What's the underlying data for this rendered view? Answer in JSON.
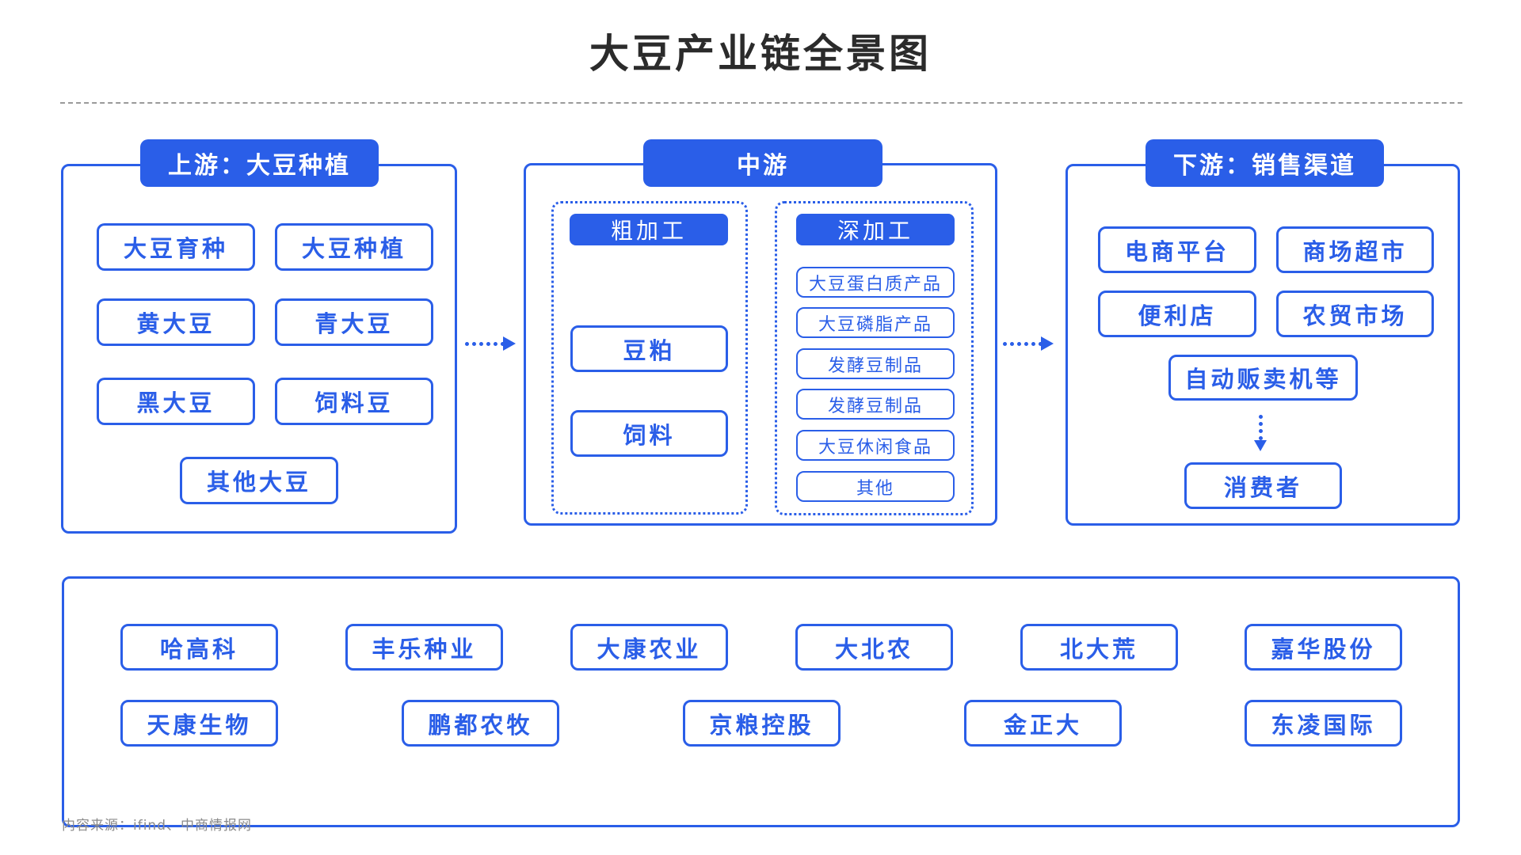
{
  "title": "大豆产业链全景图",
  "accent_color": "#2a5ee8",
  "upstream": {
    "header": "上游：大豆种植",
    "items": [
      "大豆育种",
      "大豆种植",
      "黄大豆",
      "青大豆",
      "黑大豆",
      "饲料豆",
      "其他大豆"
    ]
  },
  "midstream": {
    "header": "中游",
    "rough": {
      "header": "粗加工",
      "items": [
        "豆粕",
        "饲料"
      ]
    },
    "deep": {
      "header": "深加工",
      "items": [
        "大豆蛋白质产品",
        "大豆磷脂产品",
        "发酵豆制品",
        "发酵豆制品",
        "大豆休闲食品",
        "其他"
      ]
    }
  },
  "downstream": {
    "header": "下游：销售渠道",
    "items": [
      "电商平台",
      "商场超市",
      "便利店",
      "农贸市场",
      "自动贩卖机等"
    ],
    "consumer": "消费者"
  },
  "companies": {
    "row1": [
      "哈高科",
      "丰乐种业",
      "大康农业",
      "大北农",
      "北大荒",
      "嘉华股份"
    ],
    "row2": [
      "天康生物",
      "鹏都农牧",
      "京粮控股",
      "金正大",
      "东凌国际"
    ]
  },
  "source": "内容来源：ifind、中商情报网"
}
